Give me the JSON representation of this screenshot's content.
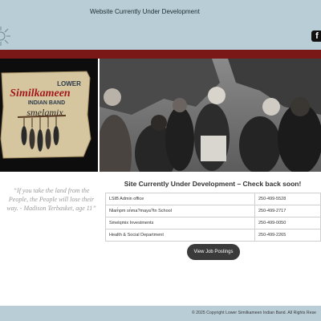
{
  "header": {
    "banner_text": "Website Currently Under Development",
    "facebook_glyph": "f",
    "facebook_icon": "facebook-icon",
    "bg_color": "#b8cdd6"
  },
  "accent_band_color": "#7a1717",
  "logo": {
    "line1": "LOWER",
    "line2": "Similkameen",
    "line3": "INDIAN BAND",
    "line4": "smelqmix"
  },
  "quote": "“If you take the land from the People, the People will lose their way. - Madison Terbasket, age 11”",
  "main": {
    "headline": "Site Currently Under Development – Check back soon!",
    "contacts": [
      {
        "dept": "LSIB Admin office",
        "phone": "250-499-5528"
      },
      {
        "dept": "Nlam̓pm sn̓ma?maya?tn School",
        "phone": "250-499-2717"
      },
      {
        "dept": "Smelqmix Investments",
        "phone": "250-499-0050"
      },
      {
        "dept": "Health & Social Department",
        "phone": "250-499-2265"
      }
    ],
    "jobs_button": "View Job Postings"
  },
  "footer": {
    "copyright": "© 2025 Copyright Lower Similkameen Indian Band. All Rights Rese"
  }
}
